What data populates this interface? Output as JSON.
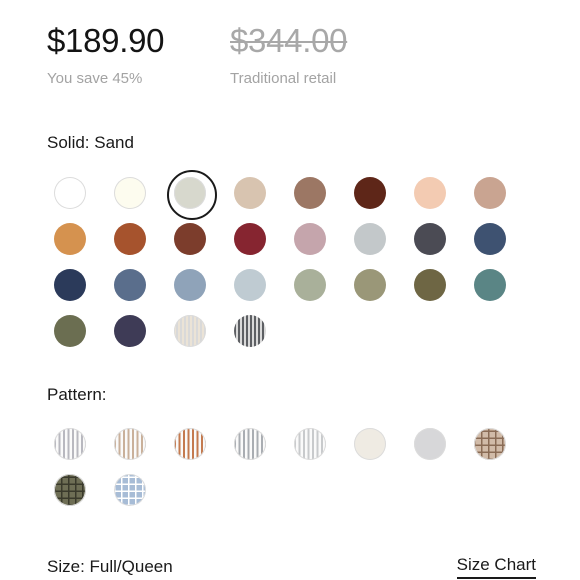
{
  "price": {
    "current": "$189.90",
    "savings": "You save 45%",
    "retail": "$344.00",
    "retail_label": "Traditional retail"
  },
  "solid": {
    "label": "Solid:",
    "selected": "Sand",
    "swatches": [
      {
        "name": "white",
        "color": "#ffffff",
        "selected": false
      },
      {
        "name": "ivory",
        "color": "#fdfcef",
        "selected": false
      },
      {
        "name": "sand",
        "color": "#d7d8cd",
        "selected": true
      },
      {
        "name": "oatmeal",
        "color": "#d8c4b0",
        "selected": false
      },
      {
        "name": "mocha",
        "color": "#9c7764",
        "selected": false
      },
      {
        "name": "chocolate",
        "color": "#5e2618",
        "selected": false
      },
      {
        "name": "peach",
        "color": "#f3cbb2",
        "selected": false
      },
      {
        "name": "taupe",
        "color": "#c9a491",
        "selected": false
      },
      {
        "name": "ochre",
        "color": "#d5924f",
        "selected": false
      },
      {
        "name": "rust",
        "color": "#a6532d",
        "selected": false
      },
      {
        "name": "brick",
        "color": "#7c3d2c",
        "selected": false
      },
      {
        "name": "cranberry",
        "color": "#862530",
        "selected": false
      },
      {
        "name": "mauve",
        "color": "#c5a5ac",
        "selected": false
      },
      {
        "name": "light-gray",
        "color": "#c3c8ca",
        "selected": false
      },
      {
        "name": "charcoal",
        "color": "#4b4b54",
        "selected": false
      },
      {
        "name": "slate-blue",
        "color": "#3e5271",
        "selected": false
      },
      {
        "name": "navy",
        "color": "#2b3a5a",
        "selected": false
      },
      {
        "name": "denim",
        "color": "#5a6e8c",
        "selected": false
      },
      {
        "name": "dusty-blue",
        "color": "#8fa3b9",
        "selected": false
      },
      {
        "name": "mist",
        "color": "#bfcbd2",
        "selected": false
      },
      {
        "name": "sage",
        "color": "#a9b09a",
        "selected": false
      },
      {
        "name": "olive-gray",
        "color": "#9a9778",
        "selected": false
      },
      {
        "name": "olive",
        "color": "#6e6644",
        "selected": false
      },
      {
        "name": "teal",
        "color": "#5a8585",
        "selected": false
      },
      {
        "name": "moss",
        "color": "#6b6e51",
        "selected": false
      },
      {
        "name": "midnight",
        "color": "#3e3b56",
        "selected": false
      },
      {
        "name": "cream-stripe",
        "color": "#ebe3d6",
        "selected": false
      },
      {
        "name": "gray-stripe",
        "color": "#5d5f63",
        "selected": false
      }
    ]
  },
  "pattern": {
    "label": "Pattern:",
    "swatches": [
      {
        "name": "gray-ticking-stripe",
        "color": "#b8b8bf"
      },
      {
        "name": "tan-stripe",
        "color": "#c9b09a"
      },
      {
        "name": "rust-stripe",
        "color": "#c47a4f"
      },
      {
        "name": "gray-stripe",
        "color": "#a9adb2"
      },
      {
        "name": "light-gray-stripe",
        "color": "#c8cacc"
      },
      {
        "name": "cream-solid",
        "color": "#efebe3"
      },
      {
        "name": "heather-gray",
        "color": "#d7d7d9"
      },
      {
        "name": "tan-plaid",
        "color": "#d1bba8"
      },
      {
        "name": "olive-plaid",
        "color": "#6e6e55"
      },
      {
        "name": "blue-plaid",
        "color": "#a7bcd6"
      }
    ]
  },
  "size": {
    "label": "Size:",
    "value": "Full/Queen",
    "chart_link": "Size Chart"
  }
}
